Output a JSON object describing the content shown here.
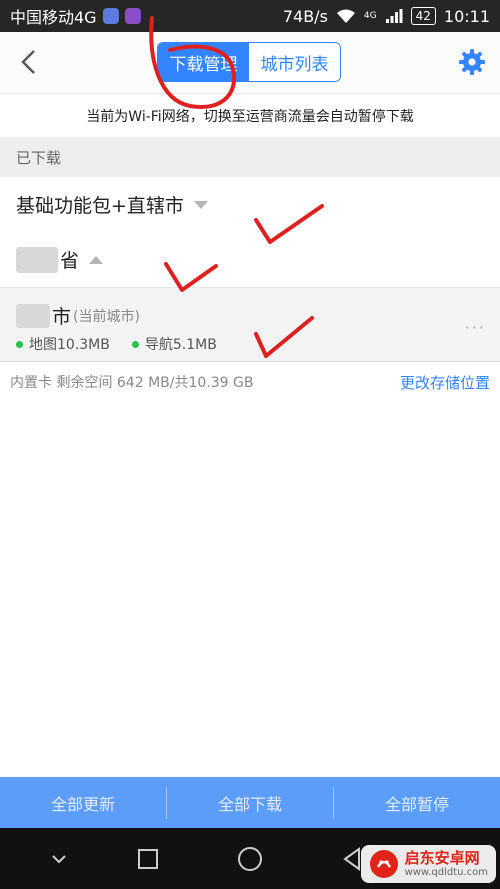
{
  "status_bar": {
    "carrier": "中国移动4G",
    "speed": "74B/s",
    "battery": "42",
    "time": "10:11",
    "network_badge": "4G"
  },
  "header": {
    "tabs": [
      {
        "label": "下载管理",
        "active": true
      },
      {
        "label": "城市列表",
        "active": false
      }
    ]
  },
  "notice": "当前为Wi-Fi网络，切换至运营商流量会自动暂停下载",
  "section_label": "已下载",
  "groups": [
    {
      "label": "基础功能包+直辖市",
      "state": "collapsed"
    },
    {
      "label": "省",
      "state": "expanded"
    }
  ],
  "city": {
    "name": "市",
    "tag": "(当前城市)",
    "map_size": "地图10.3MB",
    "nav_size": "导航5.1MB",
    "more": "···"
  },
  "storage": {
    "info": "内置卡 剩余空间 642 MB/共10.39 GB",
    "change_link": "更改存储位置"
  },
  "actions": [
    {
      "label": "全部更新"
    },
    {
      "label": "全部下载"
    },
    {
      "label": "全部暂停"
    }
  ],
  "watermark": {
    "title": "启东安卓网",
    "url": "www.qdldtu.com"
  },
  "colors": {
    "accent": "#3385ff",
    "action_bar": "#5c9dfa",
    "status_dot": "#27c24c",
    "annotation": "#e0201f"
  }
}
